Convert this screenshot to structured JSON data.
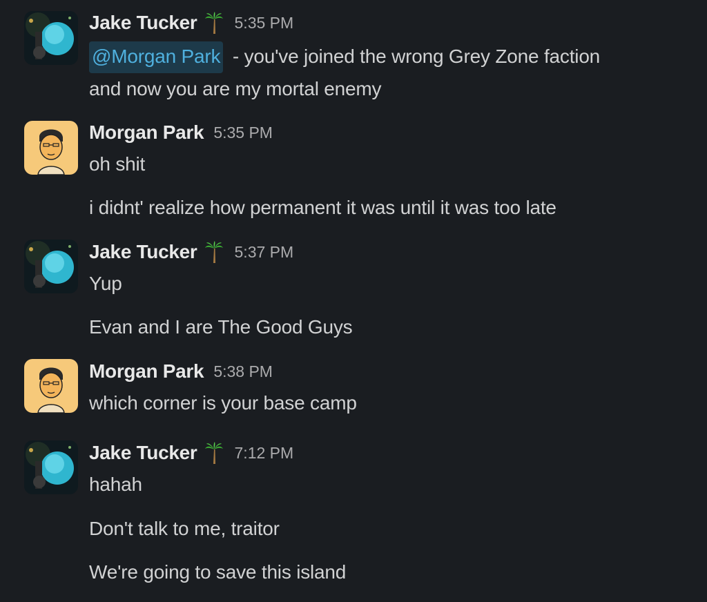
{
  "messages": [
    {
      "author": "Jake Tucker",
      "status_icon": "palm-tree-icon",
      "time": "5:35 PM",
      "mention": "@Morgan Park",
      "lines": [
        " - you've joined the wrong Grey Zone faction",
        "and now you are my mortal enemy"
      ]
    },
    {
      "author": "Morgan Park",
      "time": "5:35 PM",
      "lines": [
        "oh shit",
        "i didnt' realize how permanent it was until it was too late"
      ]
    },
    {
      "author": "Jake Tucker",
      "status_icon": "palm-tree-icon",
      "time": "5:37 PM",
      "lines": [
        "Yup",
        "Evan and I are The Good Guys"
      ]
    },
    {
      "author": "Morgan Park",
      "time": "5:38 PM",
      "lines": [
        "which corner is your base camp"
      ]
    },
    {
      "author": "Jake Tucker",
      "status_icon": "palm-tree-icon",
      "time": "7:12 PM",
      "lines": [
        "hahah",
        "Don't talk to me, traitor",
        "We're going to save this island"
      ]
    }
  ],
  "colors": {
    "background": "#1a1d21",
    "text": "#d1d2d3",
    "mention_text": "#4fb0de",
    "mention_bg": "#1d3a4a",
    "morgan_avatar_bg": "#f6c97a"
  }
}
